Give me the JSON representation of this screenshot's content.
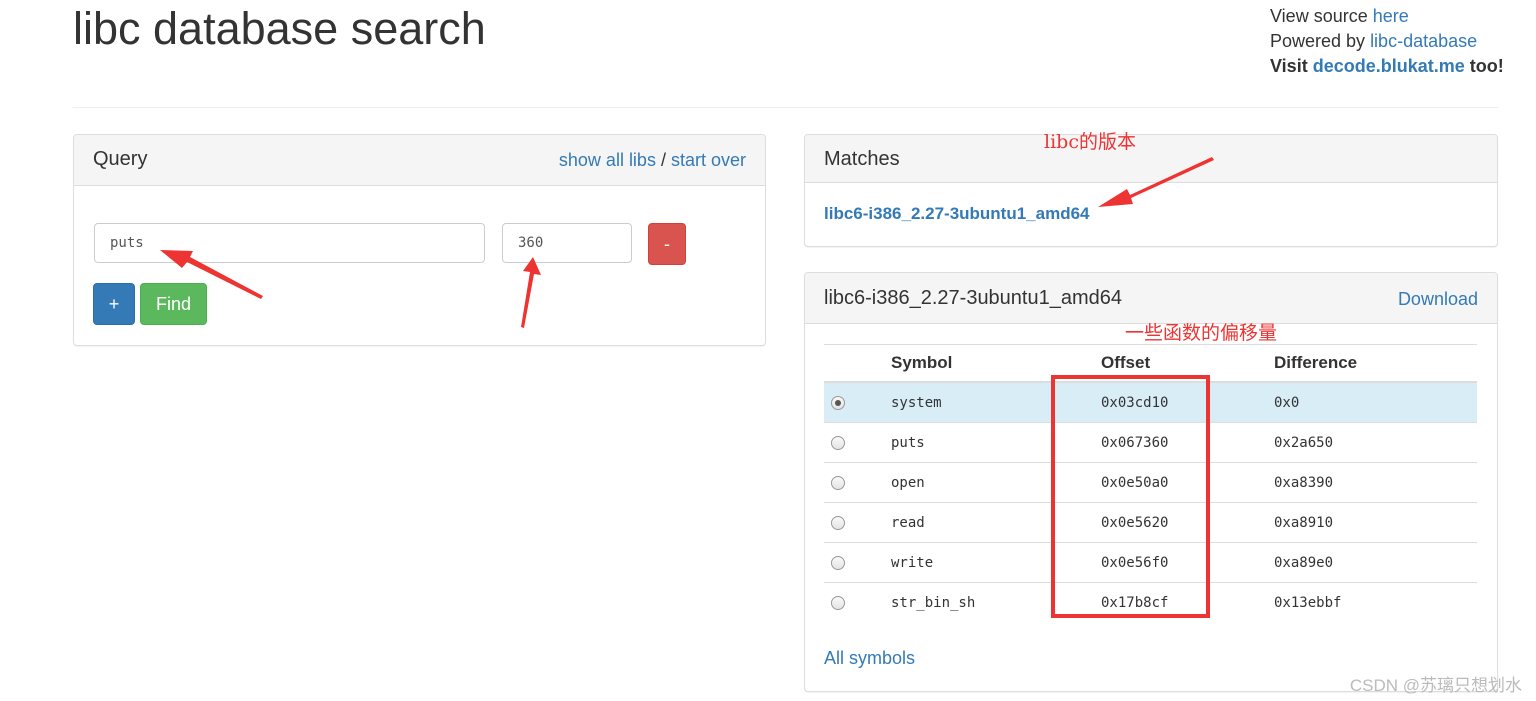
{
  "header": {
    "title": "libc database search",
    "view_source_prefix": "View source ",
    "view_source_link": "here",
    "powered_by_prefix": "Powered by ",
    "powered_by_link": "libc-database",
    "visit_prefix": "Visit ",
    "visit_link": "decode.blukat.me",
    "visit_suffix": " too!"
  },
  "query": {
    "title": "Query",
    "show_all_libs": "show all libs",
    "separator": " / ",
    "start_over": "start over",
    "symbol_value": "puts",
    "offset_value": "360",
    "remove_label": "-",
    "add_label": "+",
    "find_label": "Find"
  },
  "matches": {
    "title": "Matches",
    "item": "libc6-i386_2.27-3ubuntu1_amd64"
  },
  "lib": {
    "title": "libc6-i386_2.27-3ubuntu1_amd64",
    "download": "Download",
    "columns": [
      "Symbol",
      "Offset",
      "Difference"
    ],
    "rows": [
      {
        "symbol": "system",
        "offset": "0x03cd10",
        "difference": "0x0",
        "selected": true
      },
      {
        "symbol": "puts",
        "offset": "0x067360",
        "difference": "0x2a650",
        "selected": false
      },
      {
        "symbol": "open",
        "offset": "0x0e50a0",
        "difference": "0xa8390",
        "selected": false
      },
      {
        "symbol": "read",
        "offset": "0x0e5620",
        "difference": "0xa8910",
        "selected": false
      },
      {
        "symbol": "write",
        "offset": "0x0e56f0",
        "difference": "0xa89e0",
        "selected": false
      },
      {
        "symbol": "str_bin_sh",
        "offset": "0x17b8cf",
        "difference": "0x13ebbf",
        "selected": false
      }
    ],
    "all_symbols": "All symbols"
  },
  "annotations": {
    "version": "libc的版本",
    "offsets": "一些函数的偏移量",
    "color": "#ee3333"
  },
  "watermark": "CSDN @苏璃只想划水"
}
